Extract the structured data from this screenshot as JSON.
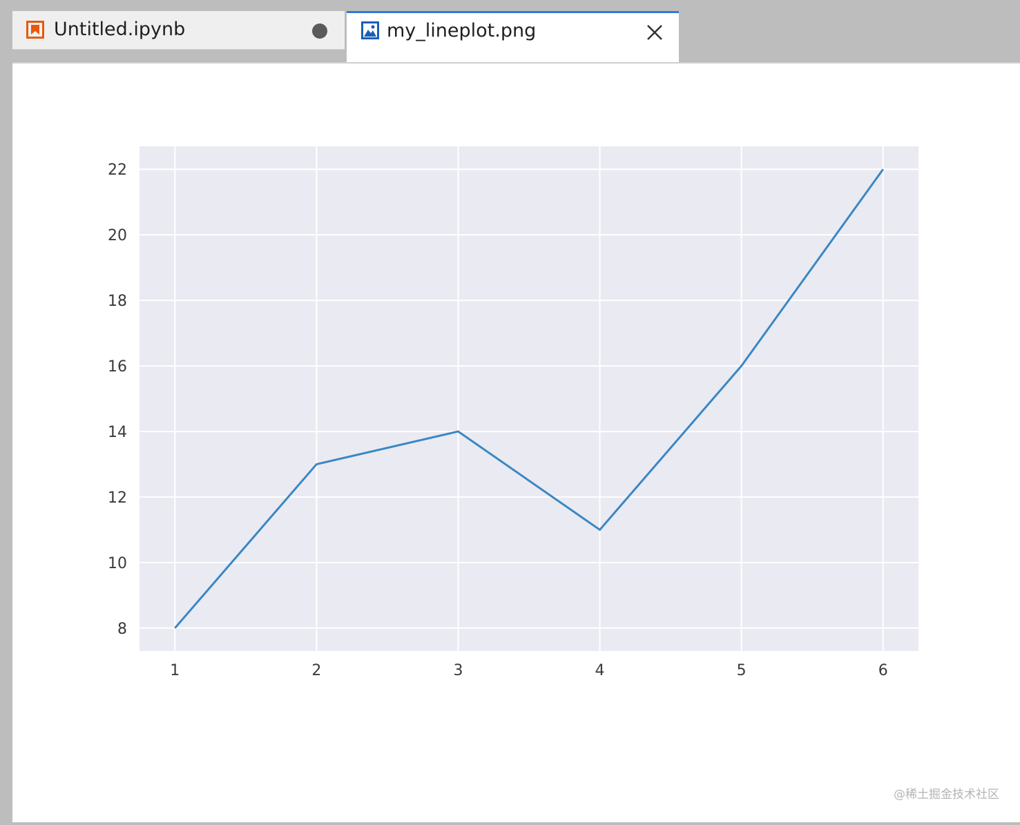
{
  "tabs": [
    {
      "label": "Untitled.ipynb",
      "icon": "notebook-icon",
      "icon_color": "#e8590c",
      "modified": true,
      "active": false
    },
    {
      "label": "my_lineplot.png",
      "icon": "image-icon",
      "icon_color": "#1a5fb4",
      "active": true
    }
  ],
  "colors": {
    "active_tab_accent": "#2f7ad9",
    "plot_background": "#eaeaf2",
    "line": "#3a87c4"
  },
  "chart_data": {
    "type": "line",
    "title": "",
    "xlabel": "",
    "ylabel": "",
    "x": [
      1,
      2,
      3,
      4,
      5,
      6
    ],
    "series": [
      {
        "values": [
          8,
          13,
          14,
          11,
          16,
          22
        ]
      }
    ],
    "xticks": [
      "1",
      "2",
      "3",
      "4",
      "5",
      "6"
    ],
    "yticks": [
      "8",
      "10",
      "12",
      "14",
      "16",
      "18",
      "20",
      "22"
    ],
    "xlim": [
      0.75,
      6.25
    ],
    "ylim": [
      7.3,
      22.7
    ],
    "grid": true,
    "legend": "none"
  },
  "watermark": "@稀土掘金技术社区"
}
